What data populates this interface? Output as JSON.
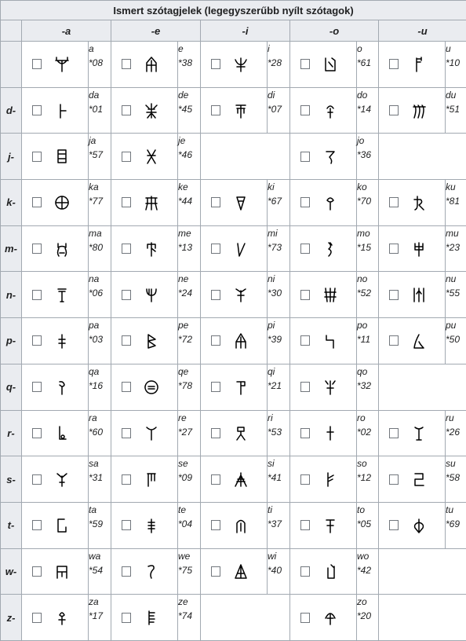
{
  "caption": "Ismert szótagjelek (legegyszerűbb nyílt szótagok)",
  "vowels": [
    "-a",
    "-e",
    "-i",
    "-o",
    "-u"
  ],
  "rows": [
    {
      "cons": "",
      "cells": [
        {
          "syl": "a",
          "code": "*08",
          "icon": "linear-b-a-icon"
        },
        {
          "syl": "e",
          "code": "*38",
          "icon": "linear-b-e-icon"
        },
        {
          "syl": "i",
          "code": "*28",
          "icon": "linear-b-i-icon"
        },
        {
          "syl": "o",
          "code": "*61",
          "icon": "linear-b-o-icon"
        },
        {
          "syl": "u",
          "code": "*10",
          "icon": "linear-b-u-icon"
        }
      ]
    },
    {
      "cons": "d-",
      "cells": [
        {
          "syl": "da",
          "code": "*01",
          "icon": "linear-b-da-icon"
        },
        {
          "syl": "de",
          "code": "*45",
          "icon": "linear-b-de-icon"
        },
        {
          "syl": "di",
          "code": "*07",
          "icon": "linear-b-di-icon"
        },
        {
          "syl": "do",
          "code": "*14",
          "icon": "linear-b-do-icon"
        },
        {
          "syl": "du",
          "code": "*51",
          "icon": "linear-b-du-icon"
        }
      ]
    },
    {
      "cons": "j-",
      "cells": [
        {
          "syl": "ja",
          "code": "*57",
          "icon": "linear-b-ja-icon"
        },
        {
          "syl": "je",
          "code": "*46",
          "icon": "linear-b-je-icon"
        },
        null,
        {
          "syl": "jo",
          "code": "*36",
          "icon": "linear-b-jo-icon"
        },
        null
      ]
    },
    {
      "cons": "k-",
      "cells": [
        {
          "syl": "ka",
          "code": "*77",
          "icon": "linear-b-ka-icon"
        },
        {
          "syl": "ke",
          "code": "*44",
          "icon": "linear-b-ke-icon"
        },
        {
          "syl": "ki",
          "code": "*67",
          "icon": "linear-b-ki-icon"
        },
        {
          "syl": "ko",
          "code": "*70",
          "icon": "linear-b-ko-icon"
        },
        {
          "syl": "ku",
          "code": "*81",
          "icon": "linear-b-ku-icon"
        }
      ]
    },
    {
      "cons": "m-",
      "cells": [
        {
          "syl": "ma",
          "code": "*80",
          "icon": "linear-b-ma-icon"
        },
        {
          "syl": "me",
          "code": "*13",
          "icon": "linear-b-me-icon"
        },
        {
          "syl": "mi",
          "code": "*73",
          "icon": "linear-b-mi-icon"
        },
        {
          "syl": "mo",
          "code": "*15",
          "icon": "linear-b-mo-icon"
        },
        {
          "syl": "mu",
          "code": "*23",
          "icon": "linear-b-mu-icon"
        }
      ]
    },
    {
      "cons": "n-",
      "cells": [
        {
          "syl": "na",
          "code": "*06",
          "icon": "linear-b-na-icon"
        },
        {
          "syl": "ne",
          "code": "*24",
          "icon": "linear-b-ne-icon"
        },
        {
          "syl": "ni",
          "code": "*30",
          "icon": "linear-b-ni-icon"
        },
        {
          "syl": "no",
          "code": "*52",
          "icon": "linear-b-no-icon"
        },
        {
          "syl": "nu",
          "code": "*55",
          "icon": "linear-b-nu-icon"
        }
      ]
    },
    {
      "cons": "p-",
      "cells": [
        {
          "syl": "pa",
          "code": "*03",
          "icon": "linear-b-pa-icon"
        },
        {
          "syl": "pe",
          "code": "*72",
          "icon": "linear-b-pe-icon"
        },
        {
          "syl": "pi",
          "code": "*39",
          "icon": "linear-b-pi-icon"
        },
        {
          "syl": "po",
          "code": "*11",
          "icon": "linear-b-po-icon"
        },
        {
          "syl": "pu",
          "code": "*50",
          "icon": "linear-b-pu-icon"
        }
      ]
    },
    {
      "cons": "q-",
      "cells": [
        {
          "syl": "qa",
          "code": "*16",
          "icon": "linear-b-qa-icon"
        },
        {
          "syl": "qe",
          "code": "*78",
          "icon": "linear-b-qe-icon"
        },
        {
          "syl": "qi",
          "code": "*21",
          "icon": "linear-b-qi-icon"
        },
        {
          "syl": "qo",
          "code": "*32",
          "icon": "linear-b-qo-icon"
        },
        null
      ]
    },
    {
      "cons": "r-",
      "cells": [
        {
          "syl": "ra",
          "code": "*60",
          "icon": "linear-b-ra-icon"
        },
        {
          "syl": "re",
          "code": "*27",
          "icon": "linear-b-re-icon"
        },
        {
          "syl": "ri",
          "code": "*53",
          "icon": "linear-b-ri-icon"
        },
        {
          "syl": "ro",
          "code": "*02",
          "icon": "linear-b-ro-icon"
        },
        {
          "syl": "ru",
          "code": "*26",
          "icon": "linear-b-ru-icon"
        }
      ]
    },
    {
      "cons": "s-",
      "cells": [
        {
          "syl": "sa",
          "code": "*31",
          "icon": "linear-b-sa-icon"
        },
        {
          "syl": "se",
          "code": "*09",
          "icon": "linear-b-se-icon"
        },
        {
          "syl": "si",
          "code": "*41",
          "icon": "linear-b-si-icon"
        },
        {
          "syl": "so",
          "code": "*12",
          "icon": "linear-b-so-icon"
        },
        {
          "syl": "su",
          "code": "*58",
          "icon": "linear-b-su-icon"
        }
      ]
    },
    {
      "cons": "t-",
      "cells": [
        {
          "syl": "ta",
          "code": "*59",
          "icon": "linear-b-ta-icon"
        },
        {
          "syl": "te",
          "code": "*04",
          "icon": "linear-b-te-icon"
        },
        {
          "syl": "ti",
          "code": "*37",
          "icon": "linear-b-ti-icon"
        },
        {
          "syl": "to",
          "code": "*05",
          "icon": "linear-b-to-icon"
        },
        {
          "syl": "tu",
          "code": "*69",
          "icon": "linear-b-tu-icon"
        }
      ]
    },
    {
      "cons": "w-",
      "cells": [
        {
          "syl": "wa",
          "code": "*54",
          "icon": "linear-b-wa-icon"
        },
        {
          "syl": "we",
          "code": "*75",
          "icon": "linear-b-we-icon"
        },
        {
          "syl": "wi",
          "code": "*40",
          "icon": "linear-b-wi-icon"
        },
        {
          "syl": "wo",
          "code": "*42",
          "icon": "linear-b-wo-icon"
        },
        null
      ]
    },
    {
      "cons": "z-",
      "cells": [
        {
          "syl": "za",
          "code": "*17",
          "icon": "linear-b-za-icon"
        },
        {
          "syl": "ze",
          "code": "*74",
          "icon": "linear-b-ze-icon"
        },
        null,
        {
          "syl": "zo",
          "code": "*20",
          "icon": "linear-b-zo-icon"
        },
        null
      ]
    }
  ]
}
